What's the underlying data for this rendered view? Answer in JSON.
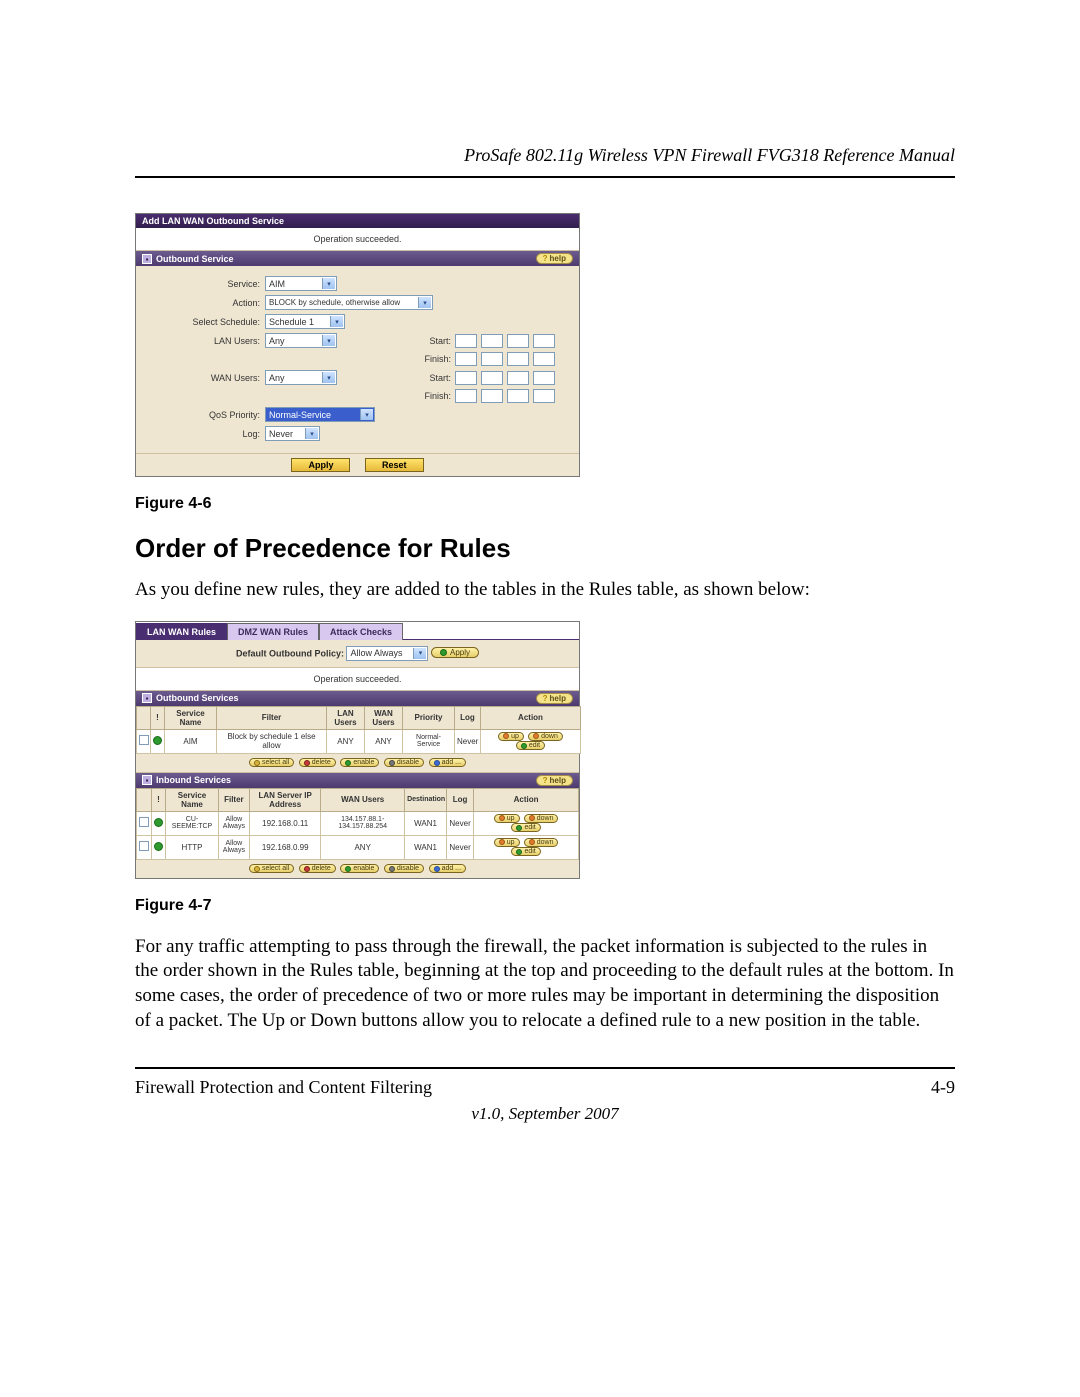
{
  "header": {
    "title": "ProSafe 802.11g Wireless VPN Firewall FVG318 Reference Manual"
  },
  "fig6": {
    "title": "Add LAN WAN Outbound Service",
    "status": "Operation succeeded.",
    "section": "Outbound Service",
    "help": "help",
    "labels": {
      "service": "Service:",
      "action": "Action:",
      "schedule": "Select Schedule:",
      "lan": "LAN Users:",
      "wan": "WAN Users:",
      "qos": "QoS Priority:",
      "log": "Log:",
      "start": "Start:",
      "finish": "Finish:"
    },
    "values": {
      "service": "AIM",
      "action": "BLOCK by schedule, otherwise allow",
      "schedule": "Schedule 1",
      "lan": "Any",
      "wan": "Any",
      "qos": "Normal-Service",
      "log": "Never"
    },
    "buttons": {
      "apply": "Apply",
      "reset": "Reset"
    },
    "caption": "Figure 4-6"
  },
  "section": {
    "heading": "Order of Precedence for Rules",
    "para1": "As you define new rules, they are added to the tables in the Rules table, as shown below:"
  },
  "fig7": {
    "tabs": [
      "LAN WAN Rules",
      "DMZ WAN Rules",
      "Attack Checks"
    ],
    "policy_label": "Default Outbound Policy:",
    "policy_value": "Allow Always",
    "apply": "Apply",
    "status": "Operation succeeded.",
    "help": "help",
    "outbound_title": "Outbound Services",
    "outbound_headers": [
      "!",
      "Service Name",
      "Filter",
      "LAN Users",
      "WAN Users",
      "Priority",
      "Log",
      "Action"
    ],
    "outbound_rows": [
      {
        "svc": "AIM",
        "filter": "Block by schedule 1 else allow",
        "lan": "ANY",
        "wan": "ANY",
        "prio": "Normal-Service",
        "log": "Never"
      }
    ],
    "inbound_title": "Inbound Services",
    "inbound_headers": [
      "!",
      "Service Name",
      "Filter",
      "LAN Server IP Address",
      "WAN Users",
      "Destination",
      "Log",
      "Action"
    ],
    "inbound_rows": [
      {
        "svc": "CU-SEEME:TCP",
        "filter": "Allow Always",
        "lanip": "192.168.0.11",
        "wan": "134.157.88.1-134.157.88.254",
        "dest": "WAN1",
        "log": "Never"
      },
      {
        "svc": "HTTP",
        "filter": "Allow Always",
        "lanip": "192.168.0.99",
        "wan": "ANY",
        "dest": "WAN1",
        "log": "Never"
      }
    ],
    "row_actions": {
      "up": "up",
      "down": "down",
      "edit": "edit"
    },
    "bar_actions": {
      "selectall": "select all",
      "delete": "delete",
      "enable": "enable",
      "disable": "disable",
      "add": "add ..."
    },
    "caption": "Figure 4-7"
  },
  "para2": "For any traffic attempting to pass through the firewall, the packet information is subjected to the rules in the order shown in the Rules table, beginning at the top and proceeding to the default rules at the bottom. In some cases, the order of precedence of two or more rules may be important in determining the disposition of a packet. The Up or Down buttons allow you to relocate a defined rule to a new position in the table.",
  "footer": {
    "left": "Firewall Protection and Content Filtering",
    "right": "4-9",
    "version": "v1.0, September 2007"
  }
}
